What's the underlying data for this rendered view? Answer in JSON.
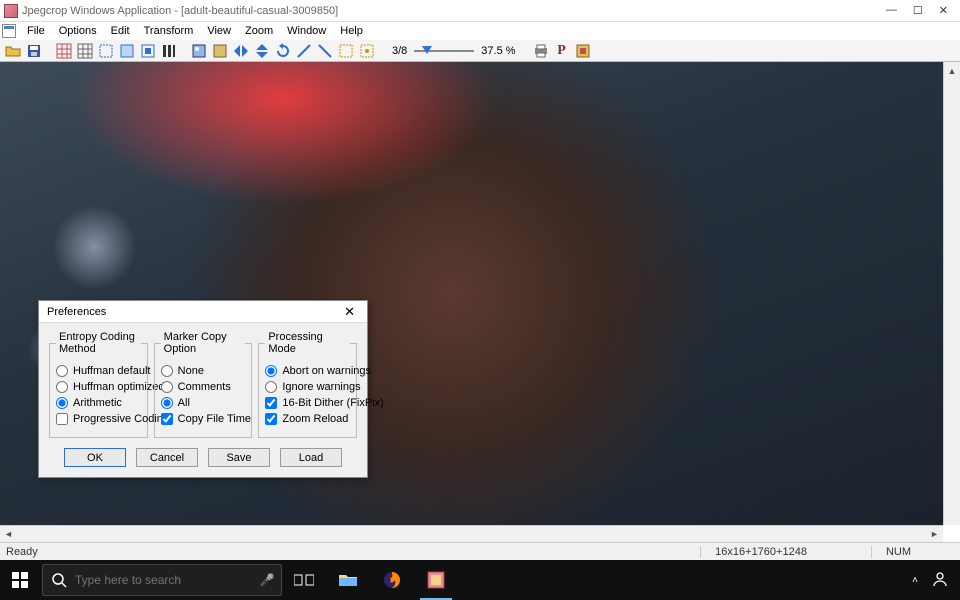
{
  "titlebar": {
    "text": "Jpegcrop Windows Application - [adult-beautiful-casual-3009850]"
  },
  "menu": {
    "items": [
      "File",
      "Options",
      "Edit",
      "Transform",
      "View",
      "Zoom",
      "Window",
      "Help"
    ]
  },
  "toolbar": {
    "frame": "3/8",
    "zoom": "37.5 %"
  },
  "dialog": {
    "title": "Preferences",
    "group_entropy": "Entropy Coding Method",
    "entropy": {
      "huffman_default": "Huffman default",
      "huffman_optimized": "Huffman optimized",
      "arithmetic": "Arithmetic"
    },
    "group_marker": "Marker Copy Option",
    "marker": {
      "none": "None",
      "comments": "Comments",
      "all": "All"
    },
    "group_proc": "Processing Mode",
    "proc": {
      "abort": "Abort on warnings",
      "ignore": "Ignore warnings"
    },
    "progressive": "Progressive Coding",
    "copytime": "Copy File Time",
    "dither": "16-Bit Dither (FixPix)",
    "zoomreload": "Zoom Reload",
    "buttons": {
      "ok": "OK",
      "cancel": "Cancel",
      "save": "Save",
      "load": "Load"
    }
  },
  "status": {
    "ready": "Ready",
    "coords": "16x16+1760+1248",
    "num": "NUM"
  },
  "taskbar": {
    "search_placeholder": "Type here to search"
  }
}
